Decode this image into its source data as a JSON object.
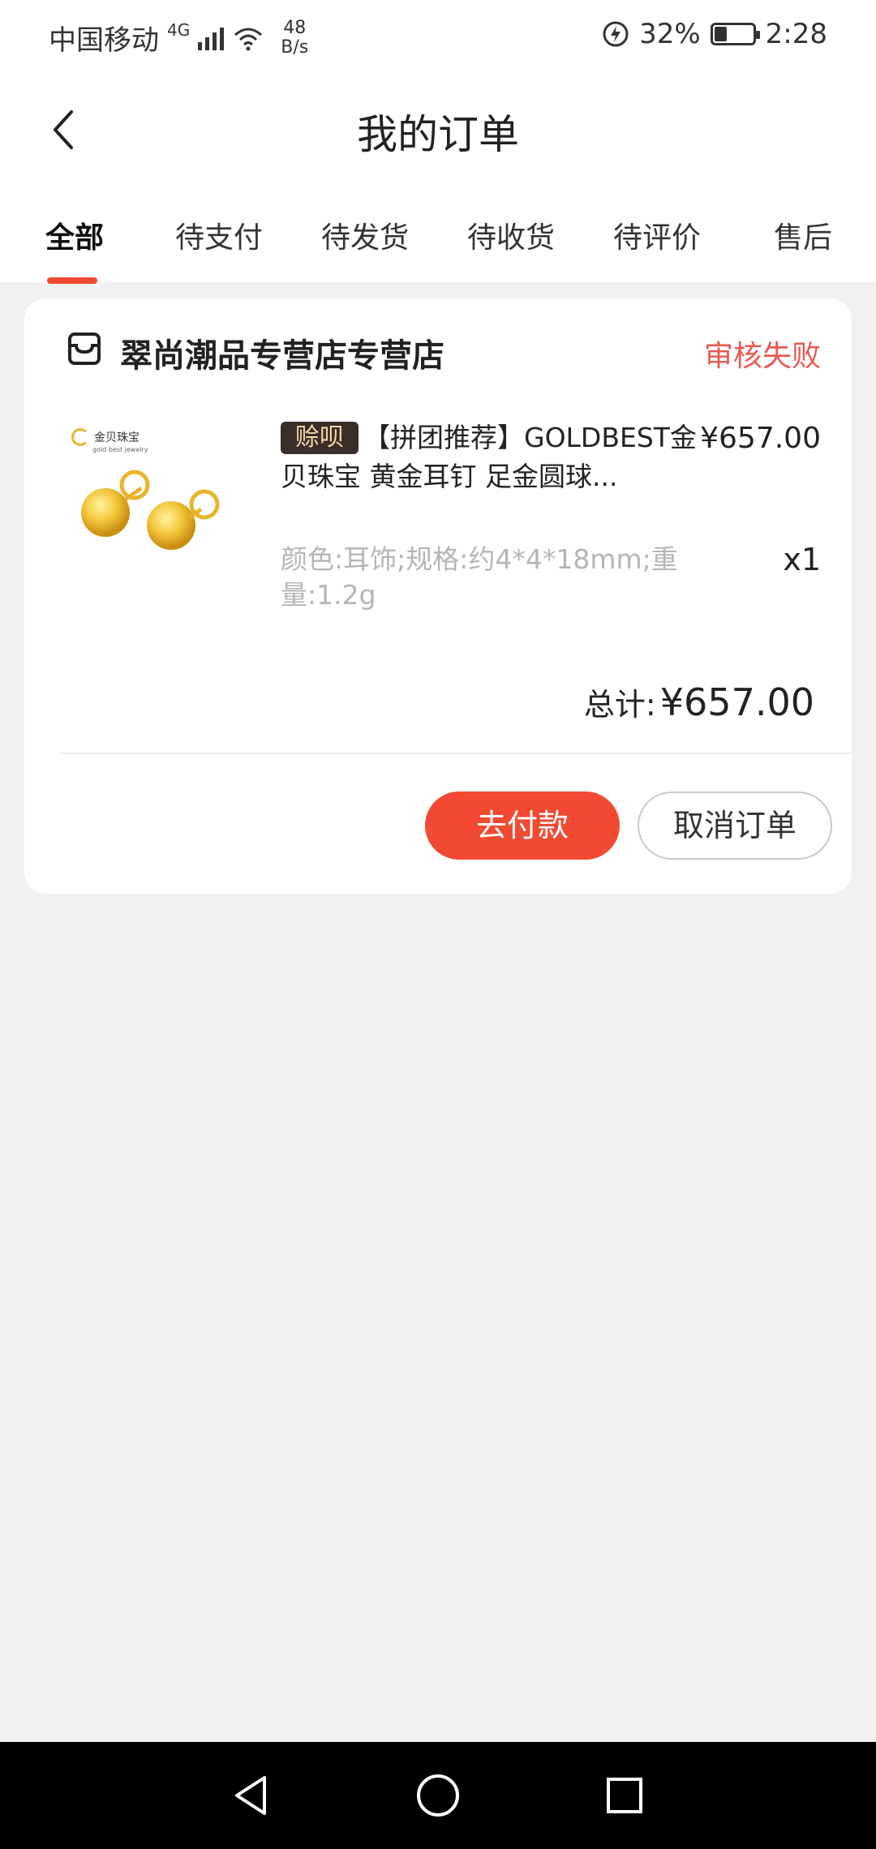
{
  "status_bar": {
    "carrier": "中国移动",
    "network": "4G",
    "speed_value": "48",
    "speed_unit": "B/s",
    "battery_percent": "32%",
    "battery_level": 0.32,
    "time": "2:28"
  },
  "header": {
    "title": "我的订单"
  },
  "tabs": [
    {
      "label": "全部",
      "active": true
    },
    {
      "label": "待支付",
      "active": false
    },
    {
      "label": "待发货",
      "active": false
    },
    {
      "label": "待收货",
      "active": false
    },
    {
      "label": "待评价",
      "active": false
    },
    {
      "label": "售后",
      "active": false
    }
  ],
  "order": {
    "shop_name": "翠尚潮品专营店专营店",
    "status": "审核失败",
    "product": {
      "brand": "金贝珠宝",
      "brand_sub": "gold best jewelry",
      "tag": "赊呗",
      "title": "【拼团推荐】GOLDBEST金贝珠宝 黄金耳钉 足金圆球...",
      "price": "¥657.00",
      "spec": "颜色:耳饰;规格:约4*4*18mm;重量:1.2g",
      "quantity": "x1"
    },
    "total_label": "总计:",
    "total_value": "¥657.00",
    "pay_button": "去付款",
    "cancel_button": "取消订单"
  },
  "icons": {
    "back": "chevron-left-icon",
    "shop": "store-icon",
    "nav_back": "triangle-back-icon",
    "nav_home": "circle-home-icon",
    "nav_recent": "square-recent-icon"
  },
  "colors": {
    "accent": "#f24a32",
    "status_fail": "#e85a52",
    "tag_bg": "#3a2e2a",
    "tag_text": "#f5d6a8"
  }
}
